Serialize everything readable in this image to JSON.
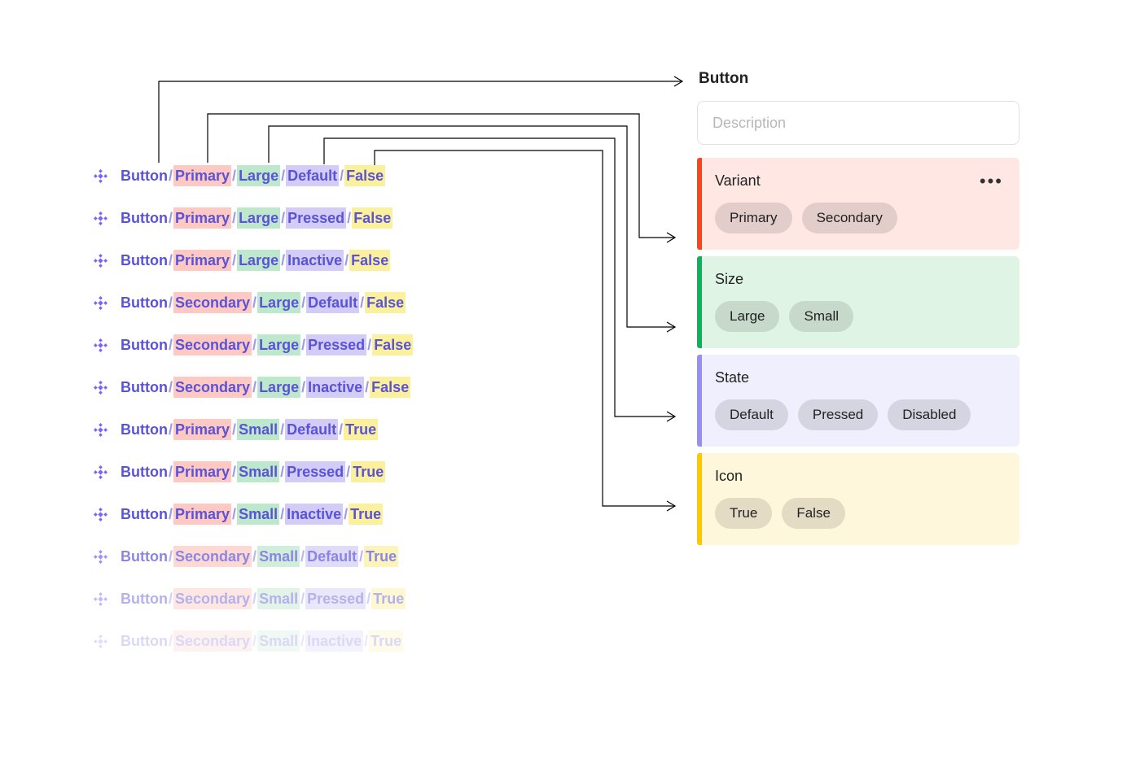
{
  "header": {
    "title": "Button",
    "description_placeholder": "Description"
  },
  "properties": [
    {
      "key": "variant",
      "label": "Variant",
      "options": [
        "Primary",
        "Secondary"
      ],
      "has_menu": true
    },
    {
      "key": "size",
      "label": "Size",
      "options": [
        "Large",
        "Small"
      ],
      "has_menu": false
    },
    {
      "key": "state",
      "label": "State",
      "options": [
        "Default",
        "Pressed",
        "Disabled"
      ],
      "has_menu": false
    },
    {
      "key": "icon",
      "label": "Icon",
      "options": [
        "True",
        "False"
      ],
      "has_menu": false
    }
  ],
  "colors": {
    "variant": {
      "bg": "#FFE7E3",
      "accent": "#F24822",
      "highlight": "#FEC9C2"
    },
    "size": {
      "bg": "#DFF4E4",
      "accent": "#14AE5C",
      "highlight": "#BDE8CB"
    },
    "state": {
      "bg": "#F0EFFD",
      "accent": "#9890F0",
      "highlight": "#D2CCF7"
    },
    "icon": {
      "bg": "#FFF7DC",
      "accent": "#FFC700",
      "highlight": "#FBF09B"
    }
  },
  "component_rows": [
    {
      "fade": 0,
      "parts": [
        "Button",
        "Primary",
        "Large",
        "Default",
        "False"
      ]
    },
    {
      "fade": 0,
      "parts": [
        "Button",
        "Primary",
        "Large",
        "Pressed",
        "False"
      ]
    },
    {
      "fade": 0,
      "parts": [
        "Button",
        "Primary",
        "Large",
        "Inactive",
        "False"
      ]
    },
    {
      "fade": 0,
      "parts": [
        "Button",
        "Secondary",
        "Large",
        "Default",
        "False"
      ]
    },
    {
      "fade": 0,
      "parts": [
        "Button",
        "Secondary",
        "Large",
        "Pressed",
        "False"
      ]
    },
    {
      "fade": 0,
      "parts": [
        "Button",
        "Secondary",
        "Large",
        "Inactive",
        "False"
      ]
    },
    {
      "fade": 0,
      "parts": [
        "Button",
        "Primary",
        "Small",
        "Default",
        "True"
      ]
    },
    {
      "fade": 0,
      "parts": [
        "Button",
        "Primary",
        "Small",
        "Pressed",
        "True"
      ]
    },
    {
      "fade": 0,
      "parts": [
        "Button",
        "Primary",
        "Small",
        "Inactive",
        "True"
      ]
    },
    {
      "fade": 1,
      "parts": [
        "Button",
        "Secondary",
        "Small",
        "Default",
        "True"
      ]
    },
    {
      "fade": 2,
      "parts": [
        "Button",
        "Secondary",
        "Small",
        "Pressed",
        "True"
      ]
    },
    {
      "fade": 3,
      "parts": [
        "Button",
        "Secondary",
        "Small",
        "Inactive",
        "True"
      ]
    }
  ],
  "part_highlights": [
    null,
    "variant",
    "size",
    "state",
    "icon"
  ]
}
